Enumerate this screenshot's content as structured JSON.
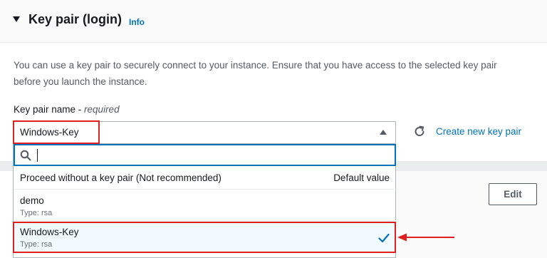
{
  "section": {
    "title": "Key pair (login)",
    "info_label": "Info",
    "description": "You can use a key pair to securely connect to your instance. Ensure that you have access to the selected key pair before you launch the instance."
  },
  "field": {
    "label": "Key pair name - ",
    "required": "required",
    "selected_value": "Windows-Key"
  },
  "actions": {
    "create_label": "Create new key pair",
    "edit_label": "Edit"
  },
  "search": {
    "value": ""
  },
  "options": {
    "proceed": {
      "label": "Proceed without a key pair (Not recommended)",
      "tag": "Default value"
    },
    "items": [
      {
        "name": "demo",
        "type": "Type: rsa"
      },
      {
        "name": "Windows-Key",
        "type": "Type: rsa"
      }
    ]
  },
  "colors": {
    "link": "#0073bb",
    "highlight": "#e02020",
    "selected_bg": "#f1faff"
  }
}
